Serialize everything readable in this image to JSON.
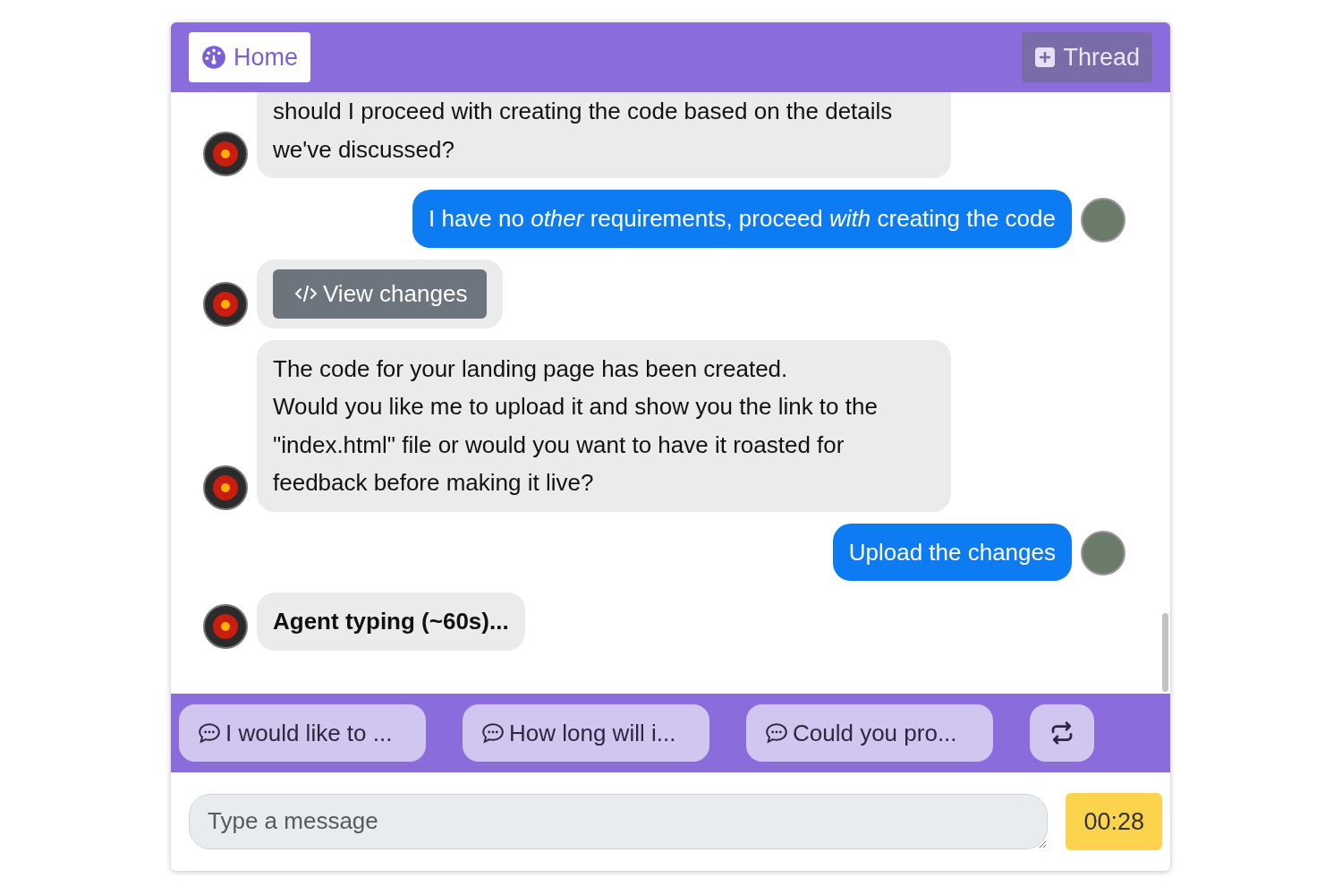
{
  "header": {
    "home_label": "Home",
    "thread_label": "Thread"
  },
  "messages": [
    {
      "kind": "text",
      "from_user": false,
      "text": "should I proceed with creating the code based on the details we've discussed?"
    },
    {
      "kind": "text",
      "from_user": true,
      "text": "I have no *other* requirements, proceed *with* creating the code"
    },
    {
      "kind": "button",
      "from_user": false,
      "text": "View changes"
    },
    {
      "kind": "text",
      "from_user": false,
      "text": "The code for your landing page has been created.\nWould you like me to upload it and show you the link to the \"index.html\" file or would you want to have it roasted for feedback before making it live?"
    },
    {
      "kind": "text",
      "from_user": true,
      "text": "Upload the changes"
    },
    {
      "kind": "typing",
      "from_user": false,
      "text": "Agent typing (~60s)..."
    }
  ],
  "suggestions": [
    "I would like to ...",
    "How long will i...",
    "Could you pro..."
  ],
  "composer": {
    "placeholder": "Type a message",
    "timer": "00:28"
  }
}
